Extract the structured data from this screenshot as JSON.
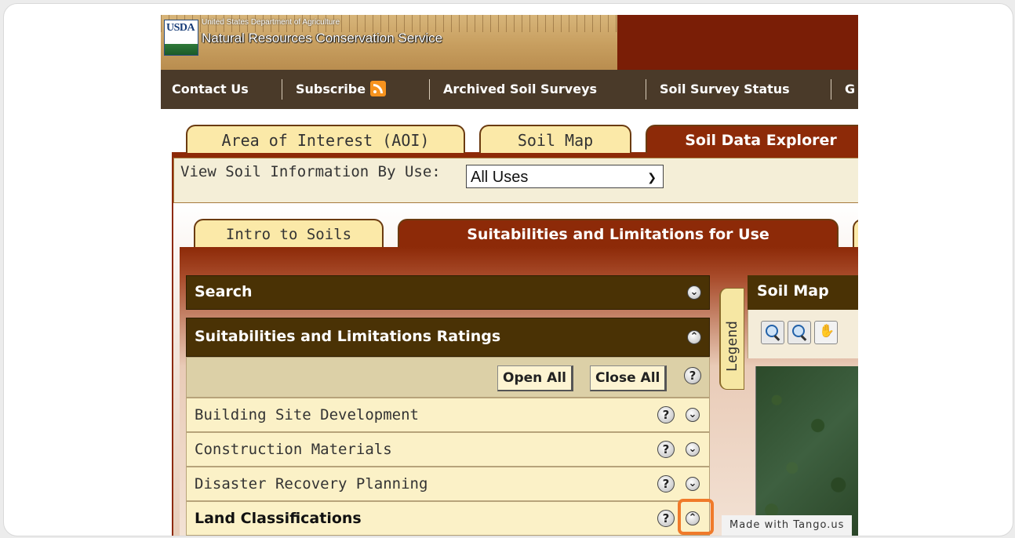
{
  "header": {
    "logo_text": "USDA",
    "department": "United States Department of Agriculture",
    "agency": "Natural Resources Conservation Service"
  },
  "nav": {
    "items": [
      {
        "label": "Contact Us"
      },
      {
        "label": "Subscribe"
      },
      {
        "label": "Archived Soil Surveys"
      },
      {
        "label": "Soil Survey Status"
      },
      {
        "label": "G"
      }
    ]
  },
  "tabs": [
    {
      "label": "Area of Interest (AOI)"
    },
    {
      "label": "Soil Map"
    },
    {
      "label": "Soil Data Explorer"
    }
  ],
  "use_bar": {
    "label": "View Soil Information By Use:",
    "selected": "All Uses"
  },
  "subtabs": [
    {
      "label": "Intro to Soils"
    },
    {
      "label": "Suitabilities and Limitations for Use"
    }
  ],
  "left_panel": {
    "search_title": "Search",
    "ratings_title": "Suitabilities and Limitations Ratings",
    "open_all": "Open All",
    "close_all": "Close All",
    "help_glyph": "?",
    "rows": [
      {
        "label": "Building Site Development"
      },
      {
        "label": "Construction Materials"
      },
      {
        "label": "Disaster Recovery Planning"
      },
      {
        "label": "Land Classifications"
      }
    ]
  },
  "legend": {
    "label": "Legend"
  },
  "map_panel": {
    "title": "Soil Map"
  },
  "watermark": "Made with Tango.us",
  "colors": {
    "banner_red": "#7a1e06",
    "nav_brown": "#4a3a29",
    "tab_active": "#8d2a08",
    "tab_inactive": "#fbe9a8",
    "panel_header": "#4a3205",
    "highlight": "#f07a2a"
  }
}
